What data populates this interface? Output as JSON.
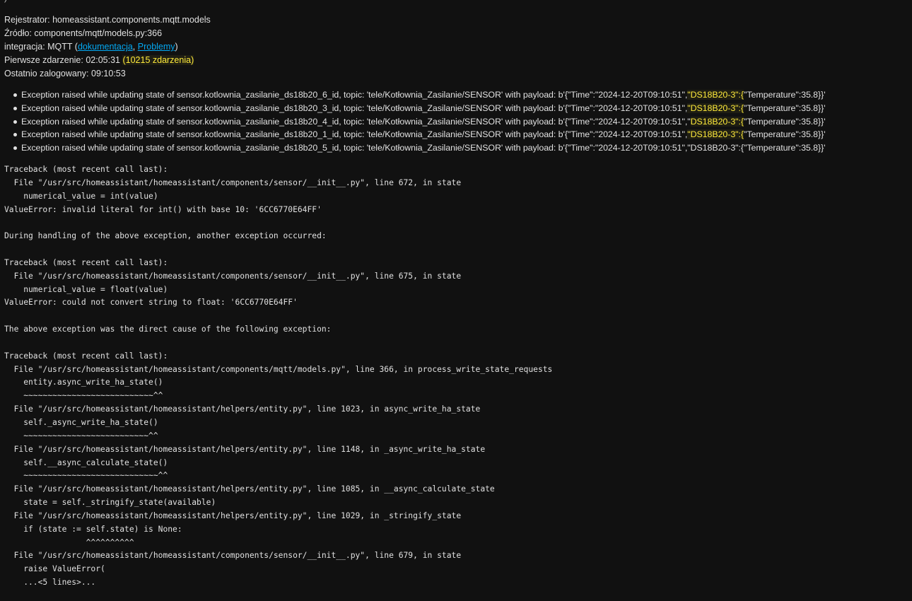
{
  "top_clip": "                                    )",
  "meta": {
    "logger_label": "Rejestrator: ",
    "logger_value": "homeassistant.components.mqtt.models",
    "source_label": "Źródło: ",
    "source_value": "components/mqtt/models.py:366",
    "integration_label": "integracja: MQTT (",
    "docs_link": "dokumentacja",
    "separator": ", ",
    "issues_link": "Problemy",
    "integration_close": ")",
    "first_label": "Pierwsze zdarzenie: 02:05:31 ",
    "first_count": "(10215 zdarzenia)",
    "last_label": "Ostatnio zalogowany: 09:10:53"
  },
  "messages": [
    {
      "prefix": "Exception raised while updating state of sensor.kotlownia_zasilanie_ds18b20_6_id, topic: 'tele/Kotłownia_Zasilanie/SENSOR' with payload: b'{\"Time\":\"2024-12-20T09:10:51\",",
      "key": "\"DS18B20-3\":{",
      "suffix": "\"Temperature\":35.8}}'",
      "highlight": true
    },
    {
      "prefix": "Exception raised while updating state of sensor.kotlownia_zasilanie_ds18b20_3_id, topic: 'tele/Kotłownia_Zasilanie/SENSOR' with payload: b'{\"Time\":\"2024-12-20T09:10:51\",",
      "key": "\"DS18B20-3\":{",
      "suffix": "\"Temperature\":35.8}}'",
      "highlight": true
    },
    {
      "prefix": "Exception raised while updating state of sensor.kotlownia_zasilanie_ds18b20_4_id, topic: 'tele/Kotłownia_Zasilanie/SENSOR' with payload: b'{\"Time\":\"2024-12-20T09:10:51\",\"",
      "key": "DS18B20-3\":{",
      "suffix": "\"Temperature\":35.8}}'",
      "highlight": true
    },
    {
      "prefix": "Exception raised while updating state of sensor.kotlownia_zasilanie_ds18b20_1_id, topic: 'tele/Kotłownia_Zasilanie/SENSOR' with payload: b'{\"Time\":\"2024-12-20T09:10:51\",",
      "key": "\"DS18B20-3\":{",
      "suffix": "\"Temperature\":35.8}}'",
      "highlight": true
    },
    {
      "prefix": "Exception raised while updating state of sensor.kotlownia_zasilanie_ds18b20_5_id, topic: 'tele/Kotłownia_Zasilanie/SENSOR' with payload: b'{\"Time\":\"2024-12-20T09:10:51\",\"DS18B20-3\":{\"Temperature\":35.8}}'",
      "key": "",
      "suffix": "",
      "highlight": false
    }
  ],
  "traceback": [
    "Traceback (most recent call last):",
    "  File \"/usr/src/homeassistant/homeassistant/components/sensor/__init__.py\", line 672, in state",
    "    numerical_value = int(value)",
    "ValueError: invalid literal for int() with base 10: '6CC6770E64FF'",
    "",
    "During handling of the above exception, another exception occurred:",
    "",
    "Traceback (most recent call last):",
    "  File \"/usr/src/homeassistant/homeassistant/components/sensor/__init__.py\", line 675, in state",
    "    numerical_value = float(value)",
    "ValueError: could not convert string to float: '6CC6770E64FF'",
    "",
    "The above exception was the direct cause of the following exception:",
    "",
    "Traceback (most recent call last):",
    "  File \"/usr/src/homeassistant/homeassistant/components/mqtt/models.py\", line 366, in process_write_state_requests",
    "    entity.async_write_ha_state()",
    "    ~~~~~~~~~~~~~~~~~~~~~~~~~~~^^",
    "  File \"/usr/src/homeassistant/homeassistant/helpers/entity.py\", line 1023, in async_write_ha_state",
    "    self._async_write_ha_state()",
    "    ~~~~~~~~~~~~~~~~~~~~~~~~~~^^",
    "  File \"/usr/src/homeassistant/homeassistant/helpers/entity.py\", line 1148, in _async_write_ha_state",
    "    self.__async_calculate_state()",
    "    ~~~~~~~~~~~~~~~~~~~~~~~~~~~~^^",
    "  File \"/usr/src/homeassistant/homeassistant/helpers/entity.py\", line 1085, in __async_calculate_state",
    "    state = self._stringify_state(available)",
    "  File \"/usr/src/homeassistant/homeassistant/helpers/entity.py\", line 1029, in _stringify_state",
    "    if (state := self.state) is None:",
    "                 ^^^^^^^^^^",
    "  File \"/usr/src/homeassistant/homeassistant/components/sensor/__init__.py\", line 679, in state",
    "    raise ValueError(",
    "    ...<5 lines>..."
  ]
}
